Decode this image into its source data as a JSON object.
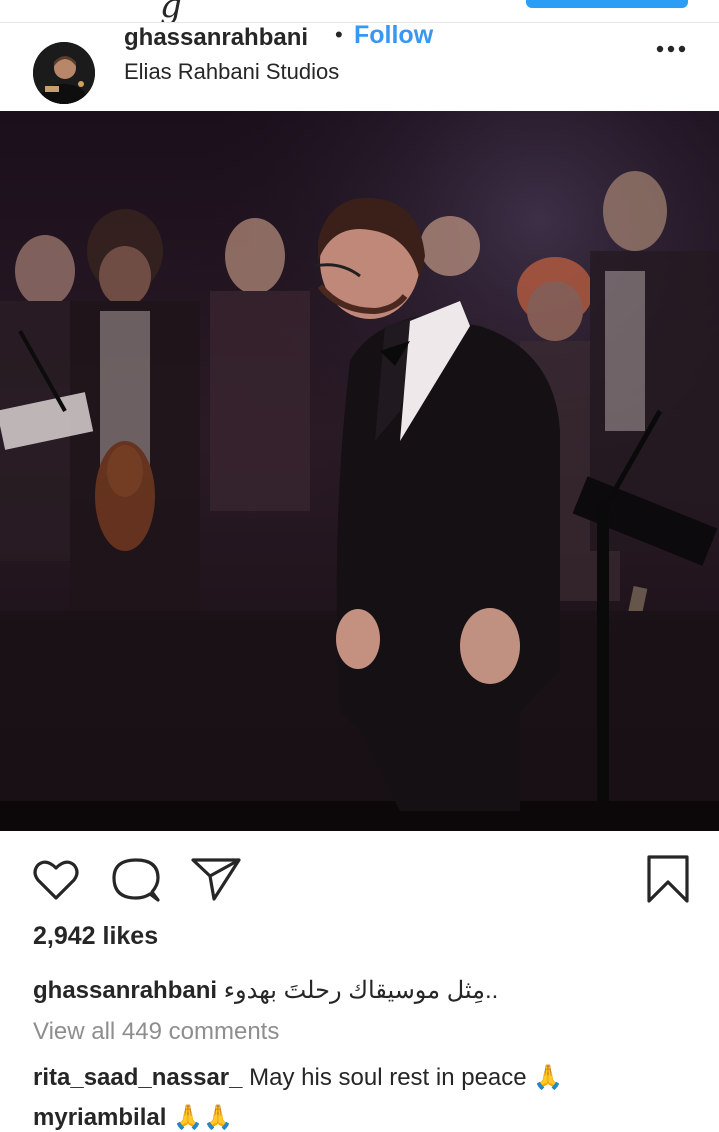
{
  "post": {
    "username": "ghassanrahbani",
    "separator": "•",
    "follow_label": "Follow",
    "location": "Elias Rahbani Studios",
    "likes": "2,942 likes",
    "caption_user": "ghassanrahbani",
    "caption_text": "مِثل موسيقاك رحلتَ بهدوء..",
    "view_all_comments": "View all 449 comments"
  },
  "comments": [
    {
      "user": "rita_saad_nassar_",
      "text": "May his soul rest in peace 🙏"
    },
    {
      "user": "myriambilal",
      "text": "🙏🙏"
    }
  ],
  "icons": {
    "like": "heart-icon",
    "comment": "comment-icon",
    "share": "send-icon",
    "save": "bookmark-icon",
    "more": "more-options-icon"
  },
  "colors": {
    "link": "#3897f0",
    "text": "#262626",
    "muted": "#8e8e8e"
  }
}
